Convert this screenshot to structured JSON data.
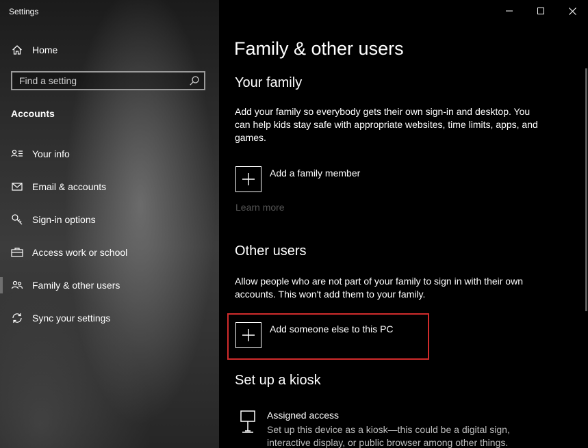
{
  "window": {
    "title": "Settings"
  },
  "sidebar": {
    "home_label": "Home",
    "search_placeholder": "Find a setting",
    "section_title": "Accounts",
    "items": [
      {
        "label": "Your info",
        "icon": "person-card-icon"
      },
      {
        "label": "Email & accounts",
        "icon": "mail-icon"
      },
      {
        "label": "Sign-in options",
        "icon": "key-icon"
      },
      {
        "label": "Access work or school",
        "icon": "briefcase-icon"
      },
      {
        "label": "Family & other users",
        "icon": "people-icon",
        "selected": true
      },
      {
        "label": "Sync your settings",
        "icon": "sync-icon"
      }
    ]
  },
  "main": {
    "page_title": "Family & other users",
    "family": {
      "heading": "Your family",
      "description": "Add your family so everybody gets their own sign-in and desktop. You can help kids stay safe with appropriate websites, time limits, apps, and games.",
      "add_label": "Add a family member",
      "learn_more": "Learn more"
    },
    "other_users": {
      "heading": "Other users",
      "description": "Allow people who are not part of your family to sign in with their own accounts. This won't add them to your family.",
      "add_label": "Add someone else to this PC"
    },
    "kiosk": {
      "heading": "Set up a kiosk",
      "item_title": "Assigned access",
      "item_description": "Set up this device as a kiosk—this could be a digital sign, interactive display, or public browser among other things."
    }
  },
  "colors": {
    "highlight": "#d12c2c",
    "main_bg": "#000000",
    "muted_link": "#555555"
  }
}
